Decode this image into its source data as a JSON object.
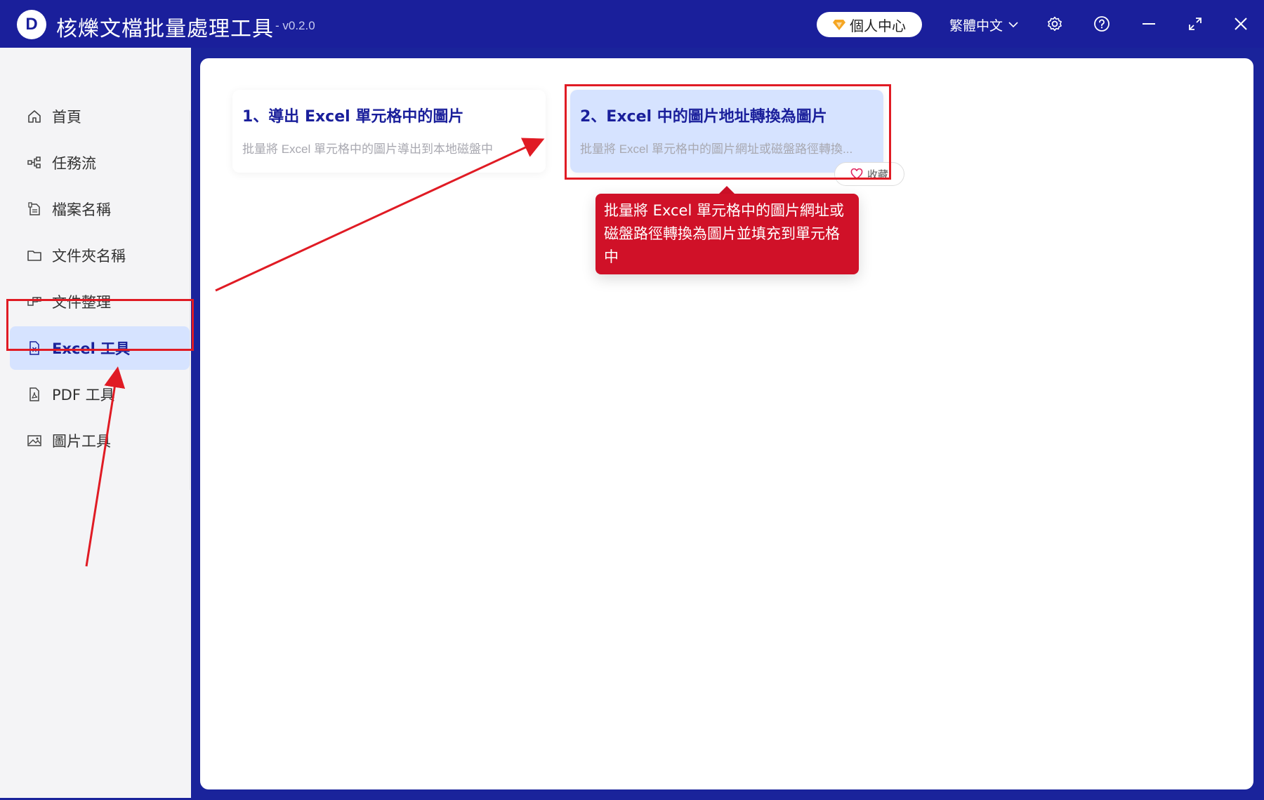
{
  "app": {
    "logo_letter": "D",
    "title": "核爍文檔批量處理工具",
    "version": "- v0.2.0",
    "user_center": "個人中心",
    "language": "繁體中文"
  },
  "sidebar": {
    "items": [
      {
        "label": "首頁",
        "icon": "home-icon"
      },
      {
        "label": "任務流",
        "icon": "workflow-icon"
      },
      {
        "label": "檔案名稱",
        "icon": "file-rename-icon"
      },
      {
        "label": "文件夾名稱",
        "icon": "folder-icon"
      },
      {
        "label": "文件整理",
        "icon": "organize-icon"
      },
      {
        "label": "Excel 工具",
        "icon": "excel-file-icon",
        "active": true
      },
      {
        "label": "PDF 工具",
        "icon": "pdf-file-icon"
      },
      {
        "label": "圖片工具",
        "icon": "image-icon"
      }
    ]
  },
  "tools": [
    {
      "title": "1、導出 Excel 單元格中的圖片",
      "desc": "批量將 Excel 單元格中的圖片導出到本地磁盤中"
    },
    {
      "title": "2、Excel 中的圖片地址轉換為圖片",
      "desc": "批量將 Excel 單元格中的圖片網址或磁盤路徑轉換..."
    }
  ],
  "favorite_label": "收藏",
  "tooltip": {
    "lines": [
      "批量將 Excel 單元格中的圖片網址或",
      "磁盤路徑轉換為圖片並填充到單元格",
      "中"
    ]
  },
  "colors": {
    "titlebar": "#1a1f9b",
    "accent": "#1a1f9b",
    "highlight_bg": "#d6e3ff",
    "annotation_red": "#e01b24",
    "tooltip_red": "#d01128"
  }
}
